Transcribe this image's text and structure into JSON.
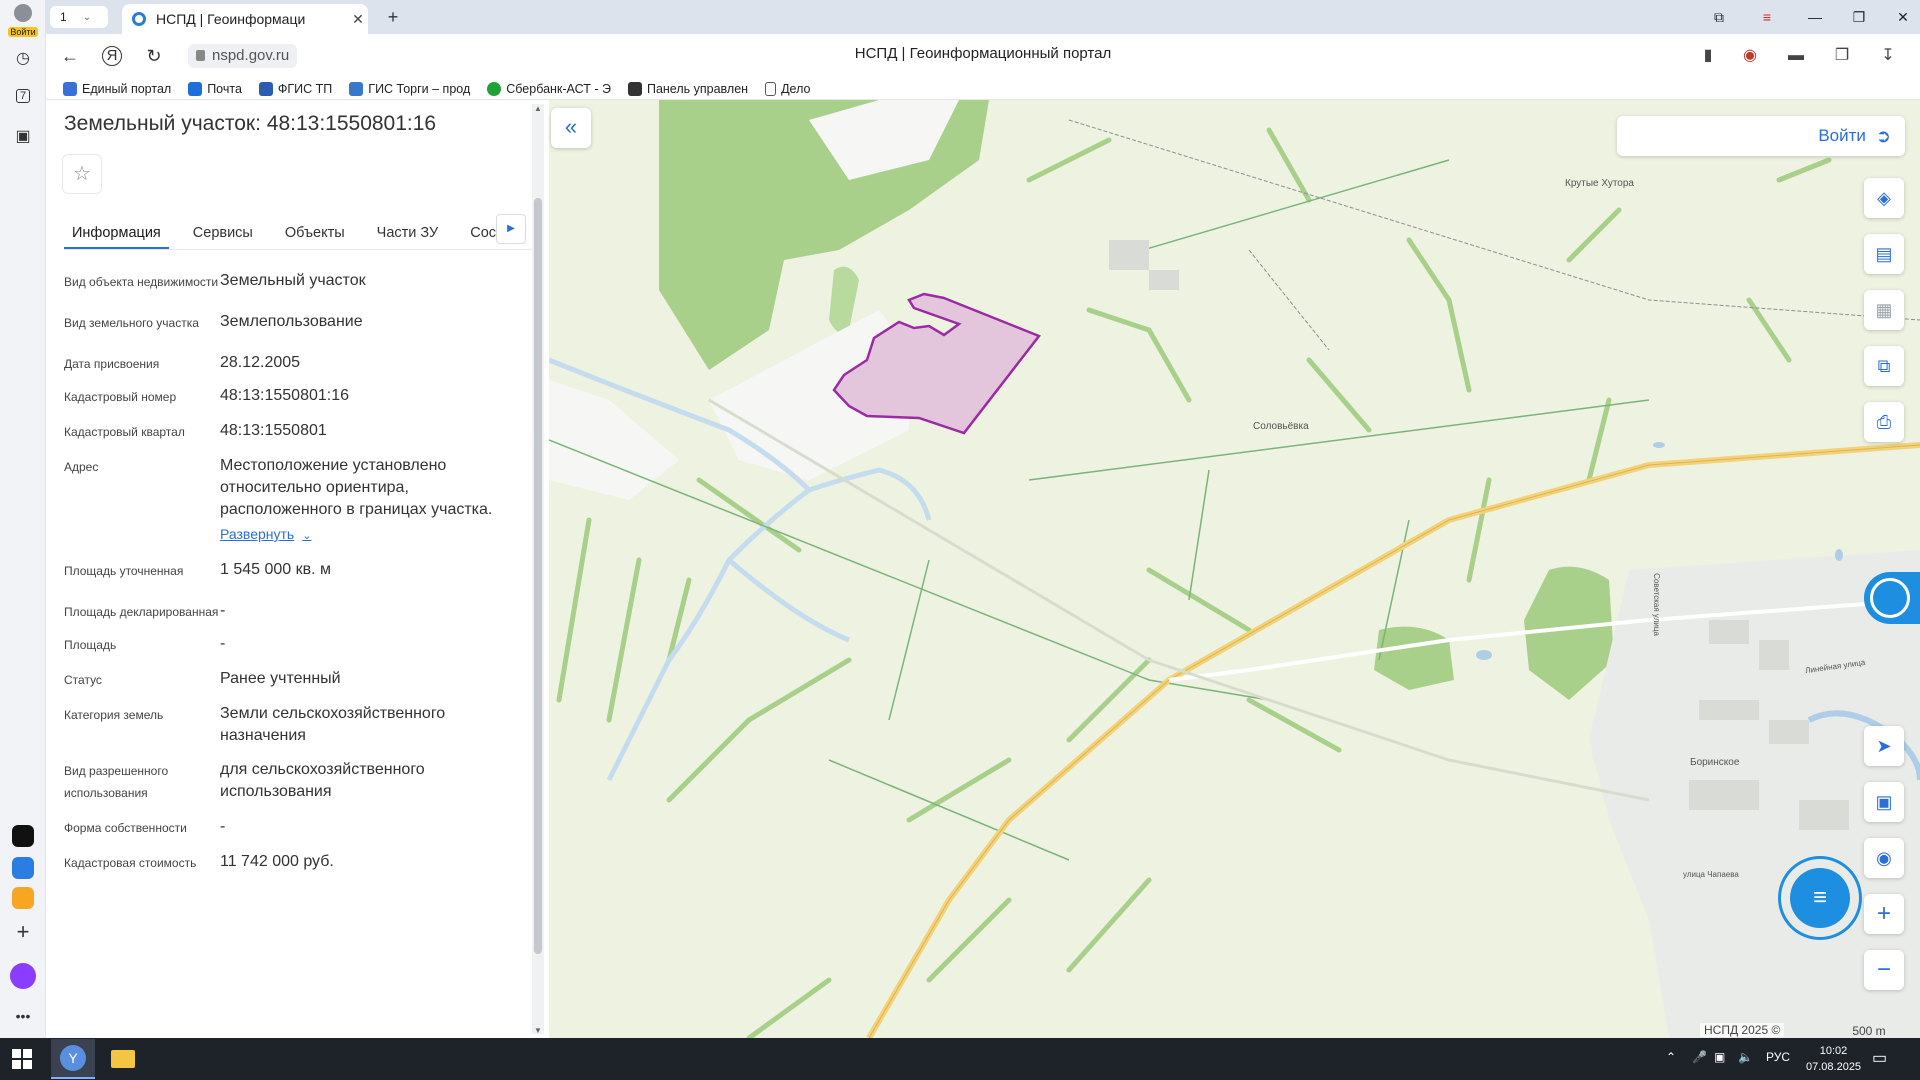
{
  "browser": {
    "sidebar": {
      "login_label": "Войти",
      "badge_number": "7"
    },
    "tab_count": "1",
    "tab_title": "НСПД | Геоинформаци",
    "url": "nspd.gov.ru",
    "page_title": "НСПД | Геоинформационный портал",
    "bookmarks": [
      {
        "label": "Единый портал",
        "color": "#3b6fd8"
      },
      {
        "label": "Почта",
        "color": "#1e6fd9"
      },
      {
        "label": "ФГИС ТП",
        "color": "#2a5db0"
      },
      {
        "label": "ГИС Торги – прод",
        "color": "#3977c9"
      },
      {
        "label": "Сбербанк-АСТ - Э",
        "color": "#21a038"
      },
      {
        "label": "Панель управлен",
        "color": "#333333"
      },
      {
        "label": "Дело",
        "color": "#ffffff"
      }
    ]
  },
  "panel": {
    "title": "Земельный участок: 48:13:1550801:16",
    "tabs": [
      "Информация",
      "Сервисы",
      "Объекты",
      "Части ЗУ",
      "Состав"
    ],
    "active_tab": "Информация",
    "expand_label": "Развернуть",
    "rows": [
      {
        "key": "Вид объекта недвижимости",
        "value": "Земельный участок"
      },
      {
        "key": "Вид земельного участка",
        "value": "Землепользование"
      },
      {
        "key": "Дата присвоения",
        "value": "28.12.2005"
      },
      {
        "key": "Кадастровый номер",
        "value": "48:13:1550801:16"
      },
      {
        "key": "Кадастровый квартал",
        "value": "48:13:1550801"
      },
      {
        "key": "Адрес",
        "value": "Местоположение установлено относительно ориентира, расположенного в границах участка."
      },
      {
        "key": "Площадь уточненная",
        "value": "1 545 000 кв. м"
      },
      {
        "key": "Площадь декларированная",
        "value": "-"
      },
      {
        "key": "Площадь",
        "value": "-"
      },
      {
        "key": "Статус",
        "value": "Ранее учтенный"
      },
      {
        "key": "Категория земель",
        "value": "Земли сельскохозяйственного назначения"
      },
      {
        "key": "Вид разрешенного использования",
        "value": "для сельскохозяйственного использования"
      },
      {
        "key": "Форма собственности",
        "value": "-"
      },
      {
        "key": "Кадастровая стоимость",
        "value": "11 742 000 руб."
      }
    ]
  },
  "map": {
    "login_label": "Войти",
    "labels": {
      "krutye_hutora": "Крутые Хутора",
      "solovevka": "Соловьёвка",
      "borinskoe": "Боринское",
      "sovetskaya": "Советская улица",
      "lineinaya": "Линейная улица",
      "chapaeva": "улица Чапаева"
    },
    "copyright": "НСПД 2025 ©",
    "scale": "500 m",
    "colors": {
      "parcel_fill": "#e3c6dc",
      "parcel_stroke": "#9b2aa3",
      "forest": "#a8d08a",
      "field": "#eef2e1",
      "road": "#f2d27a"
    }
  },
  "taskbar": {
    "lang": "РУС",
    "time": "10:02",
    "date": "07.08.2025"
  }
}
